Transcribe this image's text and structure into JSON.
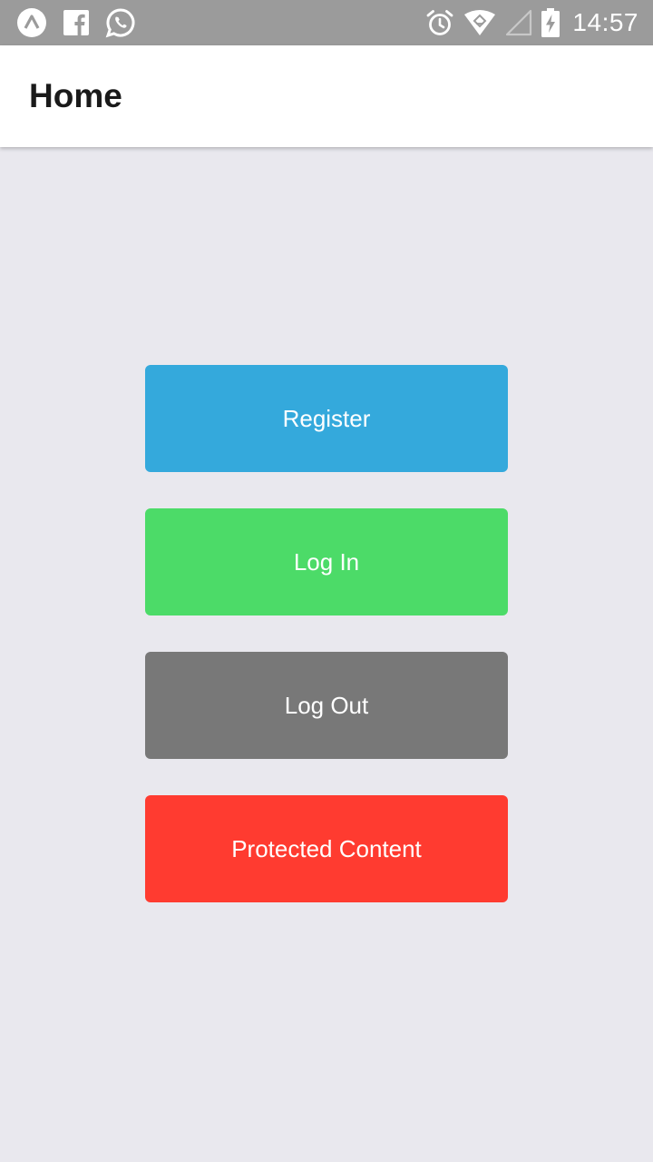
{
  "status_bar": {
    "time": "14:57",
    "left_icons": [
      "app-a-icon",
      "facebook-icon",
      "whatsapp-icon"
    ],
    "right_icons": [
      "alarm-icon",
      "wifi-icon",
      "cell-signal-icon",
      "battery-charging-icon"
    ],
    "background": "#9b9b9b"
  },
  "app_bar": {
    "title": "Home"
  },
  "buttons": [
    {
      "label": "Register",
      "color": "#34a9dc"
    },
    {
      "label": "Log In",
      "color": "#4cdb68"
    },
    {
      "label": "Log Out",
      "color": "#787878"
    },
    {
      "label": "Protected Content",
      "color": "#ff3b30"
    }
  ],
  "background": "#e9e8ee"
}
